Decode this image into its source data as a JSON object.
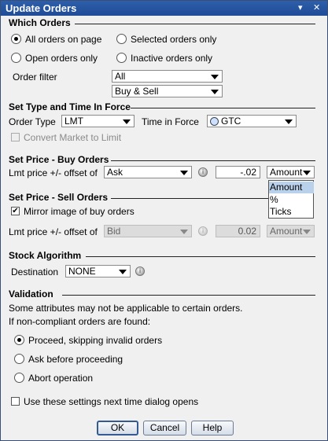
{
  "title": "Update Orders",
  "title_controls": {
    "menu_icon": "▾",
    "close_icon": "✕"
  },
  "which_orders": {
    "heading": "Which Orders",
    "all_on_page": "All orders on page",
    "selected_only": "Selected orders only",
    "open_only": "Open orders only",
    "inactive_only": "Inactive orders only",
    "order_filter_label": "Order filter",
    "filter_value": "All",
    "side_value": "Buy & Sell",
    "selected_option": "All orders on page"
  },
  "type_tif": {
    "heading": "Set Type and Time In Force",
    "order_type_label": "Order Type",
    "order_type_value": "LMT",
    "tif_label": "Time in Force",
    "tif_value": "GTC",
    "convert_label": "Convert Market to Limit"
  },
  "buy_price": {
    "heading": "Set Price - Buy Orders",
    "lmt_label": "Lmt price +/- offset of",
    "ref_value": "Ask",
    "offset_value": "-.02",
    "unit_value": "Amount",
    "unit_options": [
      "Amount",
      "%",
      "Ticks"
    ],
    "unit_highlighted": "Amount"
  },
  "sell_price": {
    "heading": "Set Price - Sell Orders",
    "mirror_label": "Mirror image of buy orders",
    "mirror_checked": true,
    "lmt_label": "Lmt price +/- offset of",
    "ref_value": "Bid",
    "offset_value": "0.02",
    "unit_value": "Amount"
  },
  "algo": {
    "heading": "Stock Algorithm",
    "dest_label": "Destination",
    "dest_value": "NONE"
  },
  "validation": {
    "heading": "Validation",
    "note1": "Some attributes may not be applicable to certain orders.",
    "note2": "If non-compliant orders are found:",
    "proceed": "Proceed, skipping invalid orders",
    "ask": "Ask before proceeding",
    "abort": "Abort operation",
    "selected_option": "Proceed, skipping invalid orders"
  },
  "remember_label": "Use these settings next time dialog opens",
  "buttons": {
    "ok": "OK",
    "cancel": "Cancel",
    "help": "Help"
  }
}
